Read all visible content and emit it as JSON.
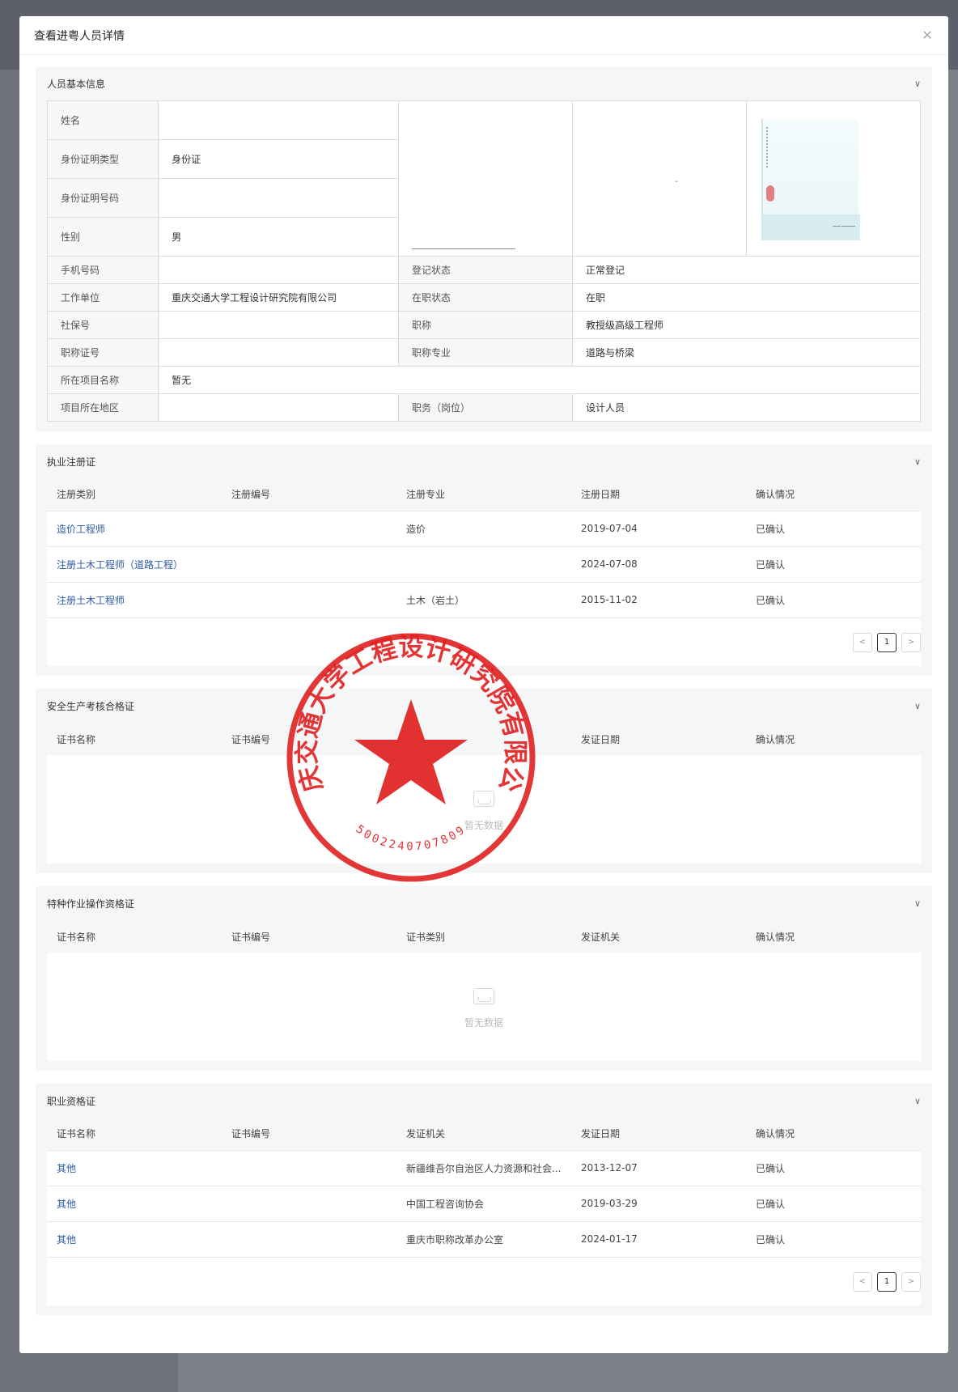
{
  "modal": {
    "title": "查看进粤人员详情",
    "close_icon": "close-icon"
  },
  "basic": {
    "title": "人员基本信息",
    "name_label": "姓名",
    "name_value": "",
    "idtype_label": "身份证明类型",
    "idtype_value": "身份证",
    "idno_label": "身份证明号码",
    "idno_value": "",
    "gender_label": "性别",
    "gender_value": "男",
    "phone_label": "手机号码",
    "phone_value": "",
    "regstatus_label": "登记状态",
    "regstatus_value": "正常登记",
    "company_label": "工作单位",
    "company_value": "重庆交通大学工程设计研究院有限公司",
    "jobstatus_label": "在职状态",
    "jobstatus_value": "在职",
    "social_label": "社保号",
    "social_value": "",
    "title_label": "职称",
    "title_value": "教授级高级工程师",
    "titlecert_label": "职称证号",
    "titlecert_value": "",
    "major_label": "职称专业",
    "major_value": "道路与桥梁",
    "project_label": "所在项目名称",
    "project_value": "暂无",
    "region_label": "项目所在地区",
    "region_value": "",
    "duty_label": "职务（岗位）",
    "duty_value": "设计人员"
  },
  "reg": {
    "title": "执业注册证",
    "headers": [
      "注册类别",
      "注册编号",
      "注册专业",
      "注册日期",
      "确认情况"
    ],
    "rows": [
      [
        "造价工程师",
        "",
        "造价",
        "2019-07-04",
        "已确认"
      ],
      [
        "注册土木工程师（道路工程）",
        "",
        "",
        "2024-07-08",
        "已确认"
      ],
      [
        "注册土木工程师",
        "",
        "土木（岩土）",
        "2015-11-02",
        "已确认"
      ]
    ],
    "page": "1"
  },
  "safety": {
    "title": "安全生产考核合格证",
    "headers": [
      "证书名称",
      "证书编号",
      "",
      "发证日期",
      "确认情况"
    ],
    "empty": "暂无数据"
  },
  "special": {
    "title": "特种作业操作资格证",
    "headers": [
      "证书名称",
      "证书编号",
      "证书类别",
      "发证机关",
      "确认情况"
    ],
    "empty": "暂无数据"
  },
  "qual": {
    "title": "职业资格证",
    "headers": [
      "证书名称",
      "证书编号",
      "发证机关",
      "发证日期",
      "确认情况"
    ],
    "rows": [
      [
        "其他",
        "",
        "新疆维吾尔自治区人力资源和社会...",
        "2013-12-07",
        "已确认"
      ],
      [
        "其他",
        "",
        "中国工程咨询协会",
        "2019-03-29",
        "已确认"
      ],
      [
        "其他",
        "",
        "重庆市职称改革办公室",
        "2024-01-17",
        "已确认"
      ]
    ],
    "page": "1"
  },
  "seal": {
    "text": "重庆交通大学工程设计研究院有限公司",
    "number": "5002240707809"
  },
  "colors": {
    "link": "#2b5aa7",
    "seal": "#e02020"
  }
}
